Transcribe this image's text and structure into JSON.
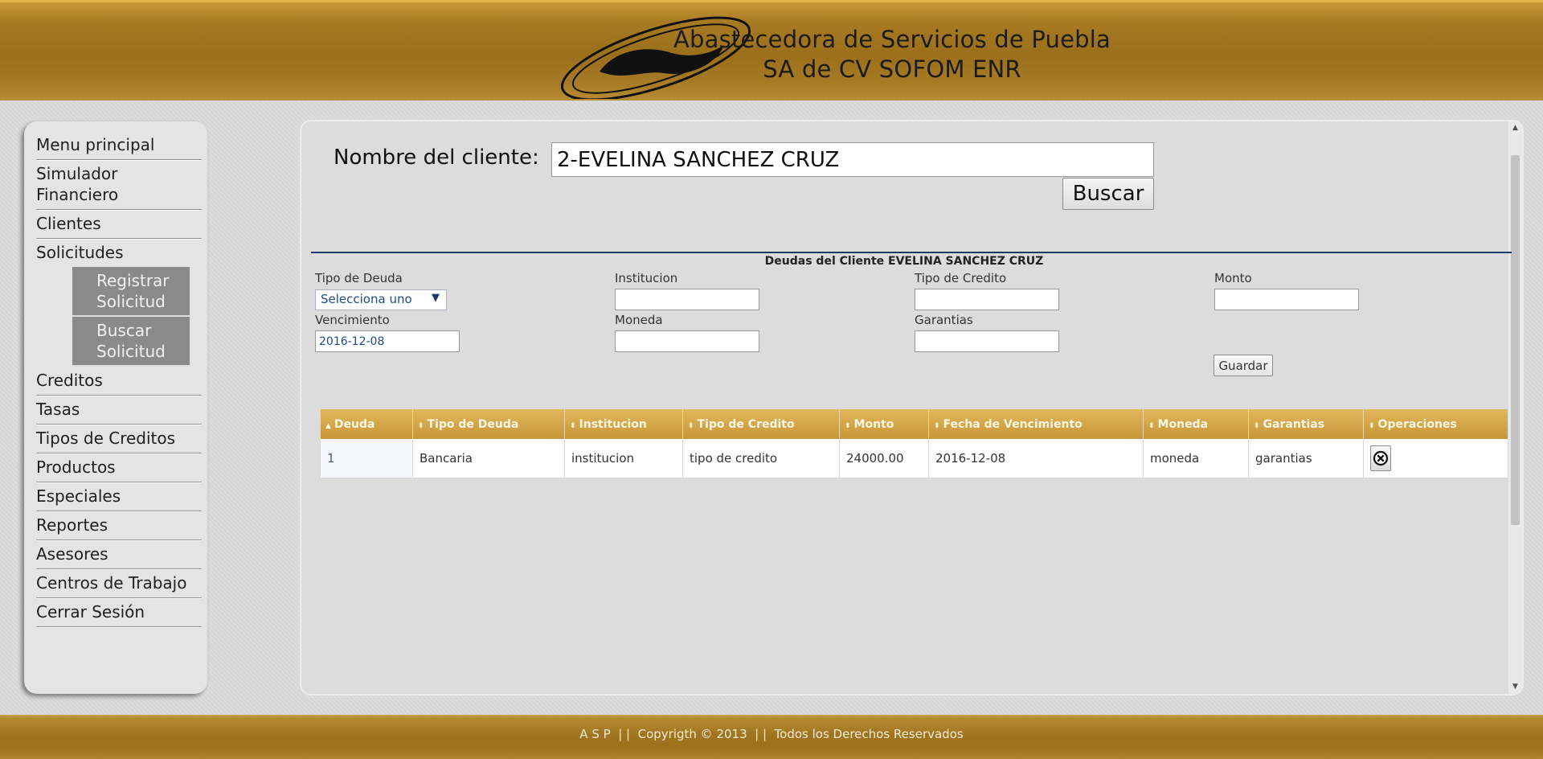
{
  "header": {
    "title_line1": "Abastecedora de Servicios de Puebla",
    "title_line2": "SA de CV SOFOM ENR"
  },
  "sidebar": {
    "items": [
      {
        "label": "Menu principal"
      },
      {
        "label": "Simulador Financiero"
      },
      {
        "label": "Clientes"
      },
      {
        "label": "Solicitudes"
      },
      {
        "label": "Creditos"
      },
      {
        "label": "Tasas"
      },
      {
        "label": "Tipos de Creditos"
      },
      {
        "label": "Productos"
      },
      {
        "label": "Especiales"
      },
      {
        "label": "Reportes"
      },
      {
        "label": "Asesores"
      },
      {
        "label": "Centros de Trabajo"
      },
      {
        "label": "Cerrar Sesión"
      }
    ],
    "submenu": [
      {
        "label": "Registrar Solicitud"
      },
      {
        "label": "Buscar Solicitud"
      }
    ]
  },
  "search": {
    "label": "Nombre del cliente:",
    "value": "2-EVELINA SANCHEZ CRUZ",
    "button": "Buscar"
  },
  "form": {
    "title": "Deudas del Cliente EVELINA SANCHEZ CRUZ",
    "tipo_deuda_label": "Tipo de Deuda",
    "tipo_deuda_value": "Selecciona uno",
    "institucion_label": "Institucion",
    "institucion_value": "",
    "tipo_credito_label": "Tipo de Credito",
    "tipo_credito_value": "",
    "monto_label": "Monto",
    "monto_value": "",
    "vencimiento_label": "Vencimiento",
    "vencimiento_value": "2016-12-08",
    "moneda_label": "Moneda",
    "moneda_value": "",
    "garantias_label": "Garantias",
    "garantias_value": "",
    "guardar": "Guardar"
  },
  "table": {
    "columns": [
      "Deuda",
      "Tipo de Deuda",
      "Institucion",
      "Tipo de Credito",
      "Monto",
      "Fecha de Vencimiento",
      "Moneda",
      "Garantias",
      "Operaciones"
    ],
    "sort_icons": [
      "▲",
      "⬍",
      "⬍",
      "⬍",
      "⬍",
      "⬍",
      "⬍",
      "⬍",
      "⬍"
    ],
    "rows": [
      [
        "1",
        "Bancaria",
        "institucion",
        "tipo de credito",
        "24000.00",
        "2016-12-08",
        "moneda",
        "garantias"
      ]
    ]
  },
  "footer": {
    "text": "A S P  | |  Copyrigth © 2013  | |  Todos los Derechos Reservados"
  },
  "icons": {
    "delete": "circle-x-icon",
    "sort": "sort-icon"
  },
  "colors": {
    "header_gold": "#a77a22",
    "table_header": "#d2a447",
    "divider": "#1f3a67"
  }
}
